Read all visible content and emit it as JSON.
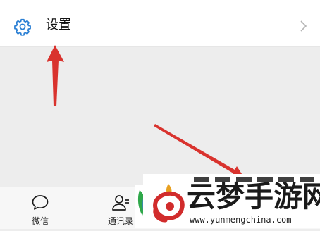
{
  "settings": {
    "label": "设置",
    "icon": "gear-icon",
    "chevron_icon": "chevron-right-icon"
  },
  "tabbar": {
    "tabs": [
      {
        "label": "微信",
        "icon": "chat-bubble-icon"
      },
      {
        "label": "通讯录",
        "icon": "contacts-icon"
      }
    ]
  },
  "watermark": {
    "title": "云梦手游网",
    "url": "www.yunmengchina.com"
  },
  "colors": {
    "accent": "#2a7fd4",
    "arrow": "#d9332e",
    "background": "#ededed",
    "card": "#ffffff",
    "watermark_red": "#d12c2c"
  }
}
